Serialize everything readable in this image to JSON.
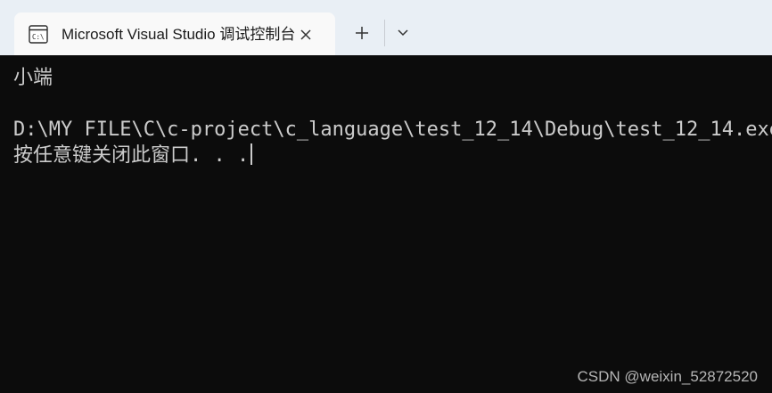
{
  "window": {
    "tab": {
      "icon": "console-icon",
      "title": "Microsoft Visual Studio 调试控制台"
    },
    "close_icon": "close-icon",
    "new_tab_icon": "plus-icon",
    "dropdown_icon": "chevron-down-icon"
  },
  "console": {
    "lines": [
      "小端",
      "D:\\MY FILE\\C\\c-project\\c_language\\test_12_14\\Debug\\test_12_14.exe",
      "按任意键关闭此窗口. . ."
    ]
  },
  "watermark": "CSDN @weixin_52872520",
  "colors": {
    "titlebar_bg": "#e9eff5",
    "tab_bg": "#f9f9f9",
    "console_bg": "#0c0c0c",
    "console_text": "#cccccc"
  }
}
